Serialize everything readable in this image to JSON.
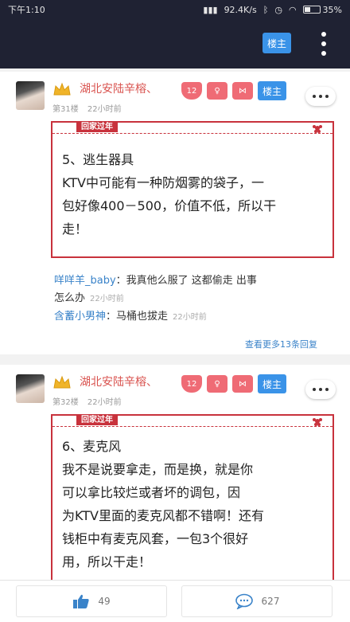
{
  "status_bar": {
    "time": "下午1:10",
    "network_speed": "92.4K/s",
    "battery": "35%"
  },
  "header": {
    "lz_button": "楼主"
  },
  "posts": [
    {
      "username": "湖北安陆辛榕、",
      "floor": "第31楼",
      "time": "22小时前",
      "level": "12",
      "lz_badge": "楼主",
      "card_tag": "回家过年",
      "content": [
        "5、逃生器具",
        "KTV中可能有一种防烟雾的袋子，一",
        "包好像400－500，价值不低，所以干",
        "走！"
      ],
      "replies": [
        {
          "name": "咩咩羊_baby",
          "text": "：我真他么服了 这都偷走 出事",
          "text2": "怎么办",
          "time": "22小时前"
        },
        {
          "name": "含蓄小男神",
          "text": "：马桶也拔走",
          "text2": "",
          "time": "22小时前"
        }
      ],
      "view_more": "查看更多13条回复"
    },
    {
      "username": "湖北安陆辛榕、",
      "floor": "第32楼",
      "time": "22小时前",
      "level": "12",
      "lz_badge": "楼主",
      "card_tag": "回家过年",
      "content": [
        "6、麦克风",
        "我不是说要拿走，而是换，就是你",
        "可以拿比较烂或者坏的调包，因",
        "为KTV里面的麦克风都不错啊！还有",
        "钱柜中有麦克风套，一包3个很好",
        "用，所以干走！"
      ]
    }
  ],
  "bottom_bar": {
    "likes": "49",
    "comments": "627"
  }
}
